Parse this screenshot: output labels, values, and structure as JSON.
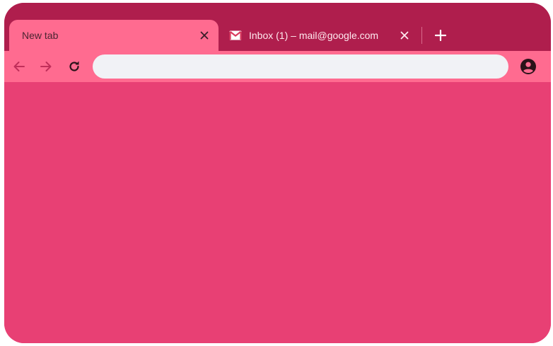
{
  "tabs": [
    {
      "title": "New tab",
      "active": true
    },
    {
      "title": "Inbox (1) – mail@google.com",
      "active": false,
      "icon": "gmail-icon"
    }
  ],
  "toolbar": {
    "back_icon": "back-arrow-icon",
    "forward_icon": "forward-arrow-icon",
    "reload_icon": "reload-icon",
    "profile_icon": "profile-avatar-icon",
    "omnibox_value": ""
  },
  "colors": {
    "frame": "#af1e4d",
    "active_tab": "#ff6b90",
    "toolbar": "#ff6b90",
    "omnibox": "#f1f2f6",
    "page_background": "#e84074"
  }
}
